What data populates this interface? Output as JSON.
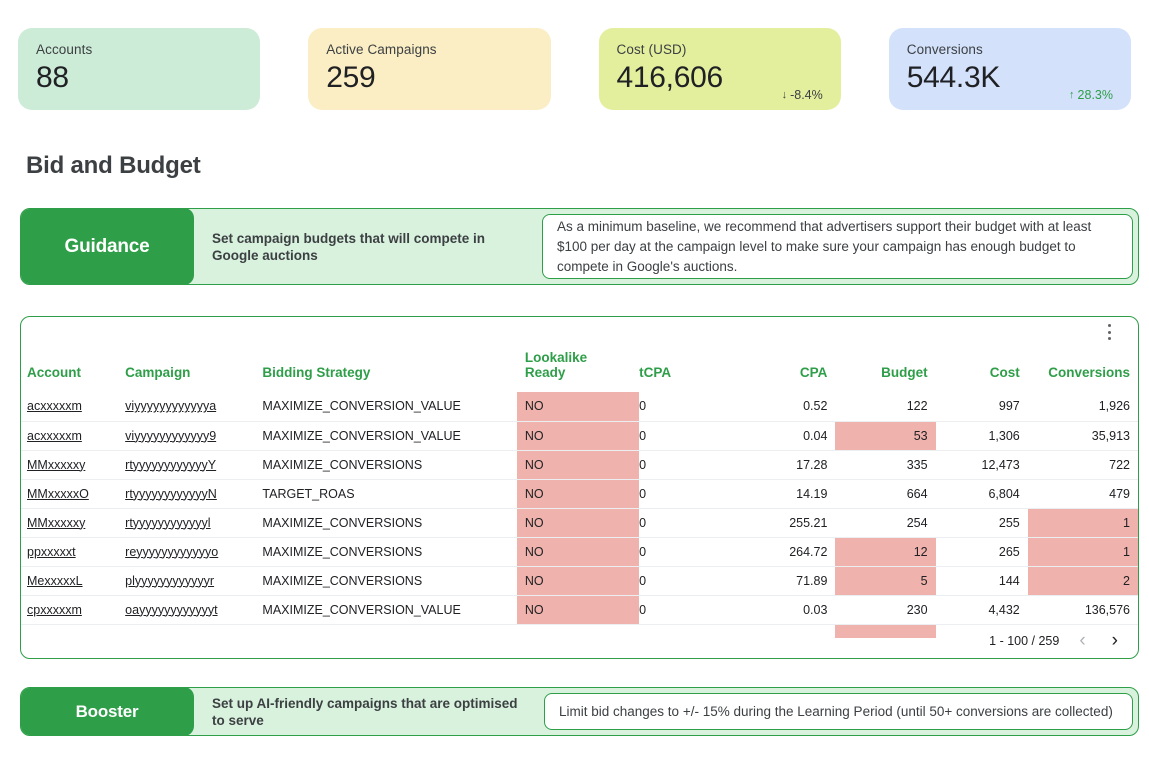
{
  "kpis": [
    {
      "label": "Accounts",
      "value": "88",
      "bg": "#cdecd7",
      "delta": null,
      "delta_dir": null,
      "delta_color": null
    },
    {
      "label": "Active Campaigns",
      "value": "259",
      "bg": "#fbeec4",
      "delta": null,
      "delta_dir": null,
      "delta_color": null
    },
    {
      "label": "Cost (USD)",
      "value": "416,606",
      "bg": "#e4ef9e",
      "delta": "-8.4%",
      "delta_dir": "down",
      "delta_color": "#3c4043"
    },
    {
      "label": "Conversions",
      "value": "544.3K",
      "bg": "#d3e1fb",
      "delta": "28.3%",
      "delta_dir": "up",
      "delta_color": "#2e9e48"
    }
  ],
  "section": {
    "title": "Bid and Budget"
  },
  "guidance": {
    "chip": "Guidance",
    "subtitle": "Set campaign budgets that will compete in Google auctions",
    "body": "As a minimum baseline, we recommend that advertisers support their budget with at least $100 per day at the campaign level to make sure your campaign has enough budget to compete in Google's auctions."
  },
  "booster": {
    "chip": "Booster",
    "subtitle": "Set up AI-friendly campaigns that are optimised to serve",
    "body": "Limit bid changes to +/- 15% during the Learning Period (until 50+ conversions are collected)"
  },
  "table": {
    "menu_icon": "kebab-menu-icon",
    "columns": [
      "Account",
      "Campaign",
      "Bidding Strategy",
      "Lookalike Ready",
      "tCPA",
      "CPA",
      "Budget",
      "Cost",
      "Conversions"
    ],
    "rows": [
      {
        "account": "acxxxxxm",
        "campaign": "viyyyyyyyyyyyya",
        "bidding": "MAXIMIZE_CONVERSION_VALUE",
        "lookalike": "NO",
        "tcpa": "0",
        "cpa": "0.52",
        "budget": "122",
        "cost": "997",
        "conversions": "1,926",
        "hl": {
          "lookalike": true,
          "budget": false,
          "conversions": false
        }
      },
      {
        "account": "acxxxxxm",
        "campaign": "viyyyyyyyyyyyy9",
        "bidding": "MAXIMIZE_CONVERSION_VALUE",
        "lookalike": "NO",
        "tcpa": "0",
        "cpa": "0.04",
        "budget": "53",
        "cost": "1,306",
        "conversions": "35,913",
        "hl": {
          "lookalike": true,
          "budget": true,
          "conversions": false
        }
      },
      {
        "account": "MMxxxxxy",
        "campaign": "rtyyyyyyyyyyyyY",
        "bidding": "MAXIMIZE_CONVERSIONS",
        "lookalike": "NO",
        "tcpa": "0",
        "cpa": "17.28",
        "budget": "335",
        "cost": "12,473",
        "conversions": "722",
        "hl": {
          "lookalike": true,
          "budget": false,
          "conversions": false
        }
      },
      {
        "account": "MMxxxxxO",
        "campaign": "rtyyyyyyyyyyyyN",
        "bidding": "TARGET_ROAS",
        "lookalike": "NO",
        "tcpa": "0",
        "cpa": "14.19",
        "budget": "664",
        "cost": "6,804",
        "conversions": "479",
        "hl": {
          "lookalike": true,
          "budget": false,
          "conversions": false
        }
      },
      {
        "account": "MMxxxxxy",
        "campaign": "rtyyyyyyyyyyyyl",
        "bidding": "MAXIMIZE_CONVERSIONS",
        "lookalike": "NO",
        "tcpa": "0",
        "cpa": "255.21",
        "budget": "254",
        "cost": "255",
        "conversions": "1",
        "hl": {
          "lookalike": true,
          "budget": false,
          "conversions": true
        }
      },
      {
        "account": "ppxxxxxt",
        "campaign": "reyyyyyyyyyyyyo",
        "bidding": "MAXIMIZE_CONVERSIONS",
        "lookalike": "NO",
        "tcpa": "0",
        "cpa": "264.72",
        "budget": "12",
        "cost": "265",
        "conversions": "1",
        "hl": {
          "lookalike": true,
          "budget": true,
          "conversions": true
        }
      },
      {
        "account": "MexxxxxL",
        "campaign": "plyyyyyyyyyyyyr",
        "bidding": "MAXIMIZE_CONVERSIONS",
        "lookalike": "NO",
        "tcpa": "0",
        "cpa": "71.89",
        "budget": "5",
        "cost": "144",
        "conversions": "2",
        "hl": {
          "lookalike": true,
          "budget": true,
          "conversions": true
        }
      },
      {
        "account": "cpxxxxxm",
        "campaign": "oayyyyyyyyyyyyt",
        "bidding": "MAXIMIZE_CONVERSION_VALUE",
        "lookalike": "NO",
        "tcpa": "0",
        "cpa": "0.03",
        "budget": "230",
        "cost": "4,432",
        "conversions": "136,576",
        "hl": {
          "lookalike": true,
          "budget": false,
          "conversions": false
        }
      }
    ],
    "pagination": {
      "range": "1 - 100 / 259",
      "prev_icon": "chevron-left-icon",
      "next_icon": "chevron-right-icon"
    }
  },
  "colors": {
    "brand_green": "#2e9e48",
    "banner_bg": "#d9f2de",
    "highlight_red": "#f0b2ac"
  }
}
